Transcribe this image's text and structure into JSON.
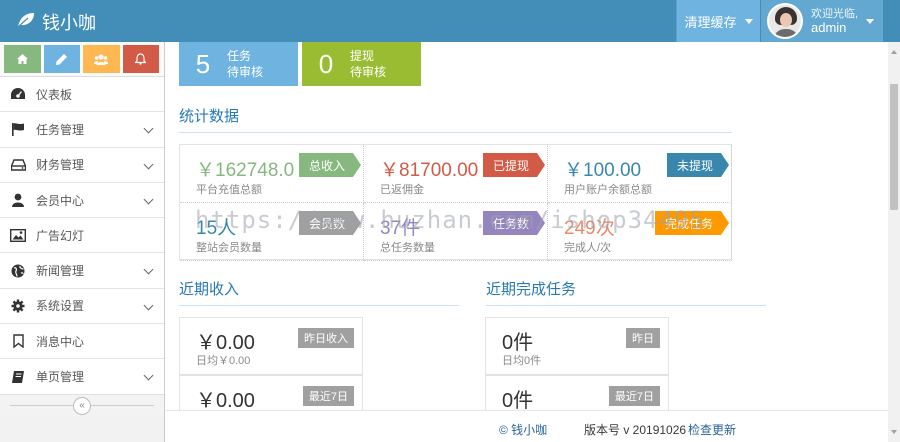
{
  "brand": {
    "name": "钱小咖",
    "icon": "leaf-icon"
  },
  "navbar": {
    "clear_cache": "清理缓存",
    "welcome": "欢迎光临,",
    "username": "admin"
  },
  "shortcuts": [
    {
      "icon": "home-icon",
      "color": "#87b87f"
    },
    {
      "icon": "pencil-icon",
      "color": "#6fb3e0"
    },
    {
      "icon": "users-icon",
      "color": "#ffb752"
    },
    {
      "icon": "bell-icon",
      "color": "#d15b47"
    }
  ],
  "sidebar": {
    "items": [
      {
        "label": "仪表板",
        "icon": "dashboard-icon",
        "has_sub": false
      },
      {
        "label": "任务管理",
        "icon": "flag-icon",
        "has_sub": true
      },
      {
        "label": "财务管理",
        "icon": "hdd-icon",
        "has_sub": true
      },
      {
        "label": "会员中心",
        "icon": "user-icon",
        "has_sub": true
      },
      {
        "label": "广告幻灯",
        "icon": "picture-icon",
        "has_sub": false
      },
      {
        "label": "新闻管理",
        "icon": "globe-icon",
        "has_sub": true
      },
      {
        "label": "系统设置",
        "icon": "gear-icon",
        "has_sub": true
      },
      {
        "label": "消息中心",
        "icon": "bookmark-icon",
        "has_sub": false
      },
      {
        "label": "单页管理",
        "icon": "book-icon",
        "has_sub": true
      }
    ]
  },
  "pending": [
    {
      "count": "5",
      "line1": "任务",
      "line2": "待审核"
    },
    {
      "count": "0",
      "line1": "提现",
      "line2": "待审核"
    }
  ],
  "stats_title": "统计数据",
  "stats": [
    {
      "value": "￥162748.0",
      "label": "平台充值总额",
      "tag": "总收入",
      "color": "#87b87f"
    },
    {
      "value": "￥81700.00",
      "label": "已返佣金",
      "tag": "已提现",
      "color": "#d15b47"
    },
    {
      "value": "￥100.00",
      "label": "用户账户余额总额",
      "tag": "未提现",
      "color": "#3a87ad"
    },
    {
      "value": "15人",
      "label": "整站会员数量",
      "tag": "会员数",
      "color": "#a0a0a0"
    },
    {
      "value": "37件",
      "label": "总任务数量",
      "tag": "任务数",
      "color": "#9585bf"
    },
    {
      "value": "249次",
      "label": "完成人/次",
      "tag": "完成任务",
      "color": "#ff9900"
    }
  ],
  "income": {
    "title": "近期收入",
    "boxes": [
      {
        "value": "￥0.00",
        "sub": "日均￥0.00",
        "badge": "昨日收入"
      },
      {
        "value": "￥0.00",
        "sub": "",
        "badge": "最近7日"
      }
    ]
  },
  "tasks": {
    "title": "近期完成任务",
    "boxes": [
      {
        "value": "0件",
        "sub": "日均0件",
        "badge": "昨日"
      },
      {
        "value": "0件",
        "sub": "",
        "badge": "最近7日"
      }
    ]
  },
  "footer": {
    "copyright": "© 钱小咖",
    "version": "版本号 v 20191026",
    "check_update": "检查更新"
  },
  "watermark": "https://www.huzhan.com/ishop34495"
}
